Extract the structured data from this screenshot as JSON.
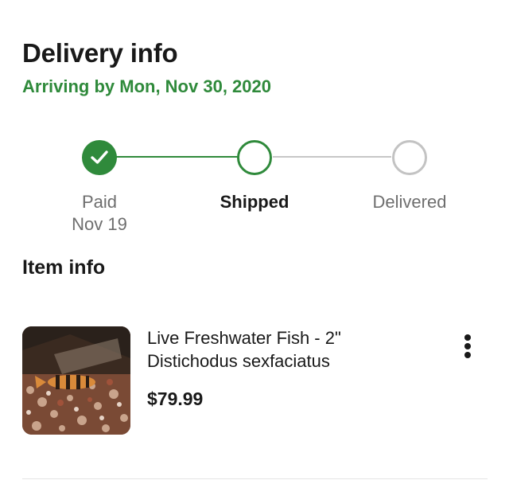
{
  "delivery": {
    "title": "Delivery info",
    "arrival": "Arriving by Mon, Nov 30, 2020"
  },
  "tracker": {
    "steps": [
      {
        "label": "Paid",
        "date": "Nov 19",
        "state": "complete"
      },
      {
        "label": "Shipped",
        "date": "",
        "state": "current"
      },
      {
        "label": "Delivered",
        "date": "",
        "state": "pending"
      }
    ],
    "colors": {
      "complete": "#2f8a3b",
      "pending": "#c3c3c3"
    }
  },
  "item_info": {
    "title": "Item info",
    "item": {
      "name_line1": "Live Freshwater Fish - 2\"",
      "name_line2": "Distichodus sexfaciatus",
      "price": "$79.99",
      "more_icon": "more-vertical-icon"
    }
  }
}
